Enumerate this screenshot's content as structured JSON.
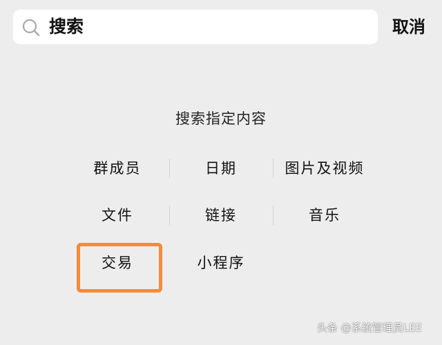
{
  "search": {
    "query": "搜索",
    "cancel_label": "取消"
  },
  "section_title": "搜索指定内容",
  "filters": [
    [
      "群成员",
      "日期",
      "图片及视频"
    ],
    [
      "文件",
      "链接",
      "音乐"
    ],
    [
      "交易",
      "小程序"
    ]
  ],
  "highlight": {
    "target": "交易",
    "color": "#f28b3c"
  },
  "watermark": "头条 @系统管理员LEE"
}
